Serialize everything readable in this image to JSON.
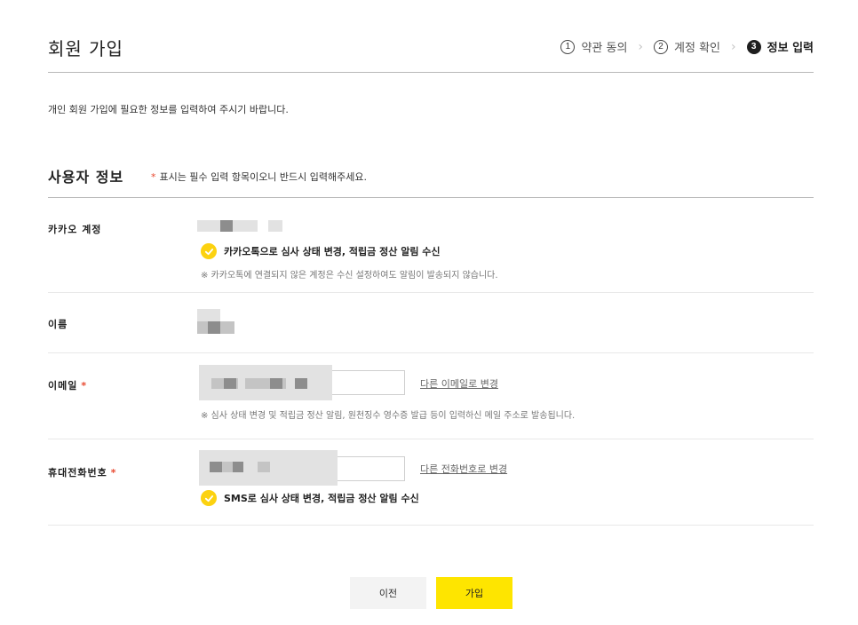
{
  "header": {
    "title": "회원 가입",
    "steps": [
      {
        "num": "1",
        "label": "약관 동의"
      },
      {
        "num": "2",
        "label": "계정 확인"
      },
      {
        "num": "3",
        "label": "정보 입력"
      }
    ]
  },
  "intro": "개인 회원 가입에 필요한 정보를 입력하여 주시기 바랍니다.",
  "section": {
    "title": "사용자 정보",
    "required_mark": "*",
    "required_note": "표시는 필수 입력 항목이오니 반드시 입력해주세요."
  },
  "kakao": {
    "label": "카카오 계정",
    "checkbox_label": "카카오톡으로 심사 상태 변경, 적립금 정산 알림 수신",
    "checked": true,
    "note": "※ 카카오톡에 연결되지 않은 계정은 수신 설정하여도 알림이 발송되지 않습니다."
  },
  "name": {
    "label": "이름"
  },
  "email": {
    "label": "이메일",
    "required_mark": "*",
    "change_link": "다른 이메일로 변경",
    "note": "※ 심사 상태 변경 및 적립금 정산 알림, 원천징수 영수증 발급 등이 입력하신 메일 주소로 발송됩니다."
  },
  "phone": {
    "label": "휴대전화번호",
    "required_mark": "*",
    "change_link": "다른 전화번호로 변경",
    "checkbox_label": "SMS로 심사 상태 변경, 적립금 정산 알림 수신",
    "checked": true
  },
  "buttons": {
    "prev": "이전",
    "join": "가입"
  },
  "colors": {
    "accent": "#fee500",
    "check": "#fcd210",
    "required": "#e8482f"
  },
  "icons": {
    "check": "check-icon"
  }
}
